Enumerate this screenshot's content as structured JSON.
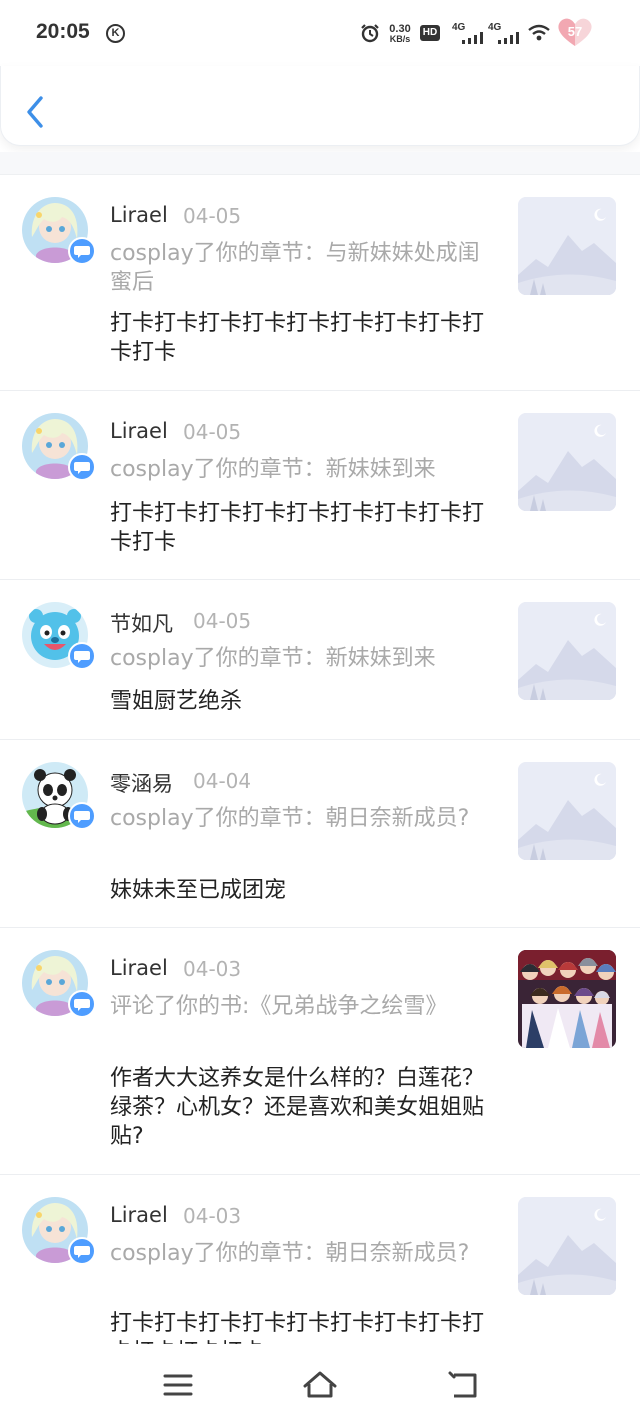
{
  "status_bar": {
    "time": "20:05",
    "k_icon": "K",
    "net_speed_value": "0.30",
    "net_speed_unit": "KB/s",
    "hd_label": "HD",
    "signal1_label": "4G",
    "signal2_label": "4G",
    "battery_level": "57",
    "icons": [
      "alarm-icon",
      "hd-icon",
      "signal-4g-icon",
      "signal-4g-icon",
      "wifi-icon",
      "heart-battery-icon"
    ]
  },
  "header": {
    "back_icon": "chevron-left-icon"
  },
  "messages": [
    {
      "name": "Lirael",
      "date": "04-05",
      "summary": "cosplay了你的章节：与新妹妹处成闺蜜后",
      "content": "打卡打卡打卡打卡打卡打卡打卡打卡打卡打卡",
      "avatar": "anime-girl-avatar",
      "thumb": "placeholder"
    },
    {
      "name": "Lirael",
      "date": "04-05",
      "summary": "cosplay了你的章节：新妹妹到来",
      "content": "打卡打卡打卡打卡打卡打卡打卡打卡打卡打卡",
      "avatar": "anime-girl-avatar",
      "thumb": "placeholder"
    },
    {
      "name": "节如凡",
      "date": "04-05",
      "summary": "cosplay了你的章节：新妹妹到来",
      "content": "雪姐厨艺绝杀",
      "avatar": "blue-mascot-avatar",
      "thumb": "placeholder"
    },
    {
      "name": "零涵易",
      "date": "04-04",
      "summary": "cosplay了你的章节：朝日奈新成员?",
      "content": "妹妹未至已成团宠",
      "avatar": "panda-avatar",
      "thumb": "placeholder"
    },
    {
      "name": "Lirael",
      "date": "04-03",
      "summary": "评论了你的书:《兄弟战争之绘雪》",
      "content": "作者大大这养女是什么样的？白莲花？绿茶？心机女？还是喜欢和美女姐姐贴贴?",
      "avatar": "anime-girl-avatar",
      "thumb": "book-cover"
    },
    {
      "name": "Lirael",
      "date": "04-03",
      "summary": "cosplay了你的章节：朝日奈新成员?",
      "content": "打卡打卡打卡打卡打卡打卡打卡打卡打卡打卡打卡打卡",
      "avatar": "anime-girl-avatar",
      "thumb": "placeholder"
    }
  ],
  "nav": {
    "menu_icon": "menu-icon",
    "home_icon": "home-icon",
    "back_icon": "back-icon"
  },
  "colors": {
    "accent": "#4e9dff",
    "back_chevron": "#3d8fe8",
    "muted_text": "#a9a9a9"
  }
}
